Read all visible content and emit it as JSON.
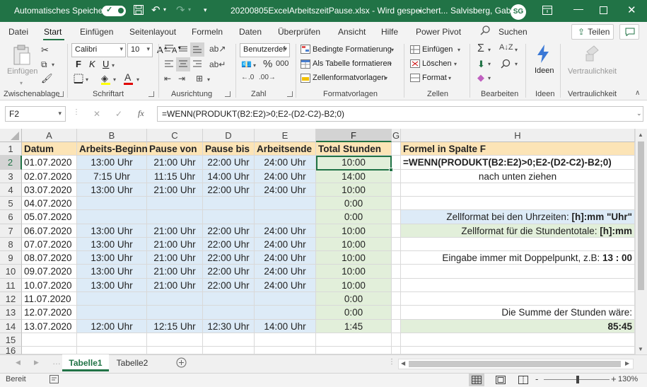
{
  "titlebar": {
    "autosave_label": "Automatisches Speichern",
    "autosave_state": "Ein",
    "doc_title": "20200805ExcelArbeitszeitPause.xlsx - Wird gespeichert... ",
    "user_name": "Salvisberg, Gaby",
    "user_initials": "SG"
  },
  "tabs": [
    "Datei",
    "Start",
    "Einfügen",
    "Seitenlayout",
    "Formeln",
    "Daten",
    "Überprüfen",
    "Ansicht",
    "Hilfe",
    "Power Pivot"
  ],
  "active_tab": "Start",
  "search_label": "Suchen",
  "share_label": "Teilen",
  "ribbon": {
    "clipboard": {
      "paste": "Einfügen",
      "label": "Zwischenablage"
    },
    "font": {
      "name": "Calibri",
      "size": "10",
      "bold": "F",
      "italic": "K",
      "underline": "U",
      "label": "Schriftart"
    },
    "alignment": {
      "label": "Ausrichtung"
    },
    "number": {
      "format": "Benutzerdef",
      "label": "Zahl"
    },
    "styles": {
      "conditional": "Bedingte Formatierung",
      "as_table": "Als Tabelle formatieren",
      "cell_styles": "Zellenformatvorlagen",
      "label": "Formatvorlagen"
    },
    "cells": {
      "insert": "Einfügen",
      "delete": "Löschen",
      "format": "Format",
      "label": "Zellen"
    },
    "editing": {
      "label": "Bearbeiten"
    },
    "ideas": {
      "button": "Ideen",
      "label": "Ideen"
    },
    "sensitivity": {
      "button": "Vertraulichkeit",
      "label": "Vertraulichkeit"
    }
  },
  "formula_bar": {
    "name_box": "F2",
    "fx": "fx",
    "formula": "=WENN(PRODUKT(B2:E2)>0;E2-(D2-C2)-B2;0)"
  },
  "columns": [
    "A",
    "B",
    "C",
    "D",
    "E",
    "F",
    "G",
    "H"
  ],
  "rows": [
    "1",
    "2",
    "3",
    "4",
    "5",
    "6",
    "7",
    "8",
    "9",
    "10",
    "11",
    "12",
    "13",
    "14",
    "15",
    "16"
  ],
  "headers": {
    "datum": "Datum",
    "beginn": "Arbeits-Beginn",
    "pause_von": "Pause von",
    "pause_bis": "Pause bis",
    "ende": "Arbeitsende",
    "total": "Total Stunden",
    "h_title": "Formel in Spalte F"
  },
  "data_rows": [
    {
      "datum": "01.07.2020",
      "beginn": "13:00 Uhr",
      "pause_von": "21:00 Uhr",
      "pause_bis": "22:00 Uhr",
      "ende": "24:00 Uhr",
      "total": "10:00"
    },
    {
      "datum": "02.07.2020",
      "beginn": "7:15 Uhr",
      "pause_von": "11:15 Uhr",
      "pause_bis": "14:00 Uhr",
      "ende": "24:00 Uhr",
      "total": "14:00"
    },
    {
      "datum": "03.07.2020",
      "beginn": "13:00 Uhr",
      "pause_von": "21:00 Uhr",
      "pause_bis": "22:00 Uhr",
      "ende": "24:00 Uhr",
      "total": "10:00"
    },
    {
      "datum": "04.07.2020",
      "beginn": "",
      "pause_von": "",
      "pause_bis": "",
      "ende": "",
      "total": "0:00"
    },
    {
      "datum": "05.07.2020",
      "beginn": "",
      "pause_von": "",
      "pause_bis": "",
      "ende": "",
      "total": "0:00"
    },
    {
      "datum": "06.07.2020",
      "beginn": "13:00 Uhr",
      "pause_von": "21:00 Uhr",
      "pause_bis": "22:00 Uhr",
      "ende": "24:00 Uhr",
      "total": "10:00"
    },
    {
      "datum": "07.07.2020",
      "beginn": "13:00 Uhr",
      "pause_von": "21:00 Uhr",
      "pause_bis": "22:00 Uhr",
      "ende": "24:00 Uhr",
      "total": "10:00"
    },
    {
      "datum": "08.07.2020",
      "beginn": "13:00 Uhr",
      "pause_von": "21:00 Uhr",
      "pause_bis": "22:00 Uhr",
      "ende": "24:00 Uhr",
      "total": "10:00"
    },
    {
      "datum": "09.07.2020",
      "beginn": "13:00 Uhr",
      "pause_von": "21:00 Uhr",
      "pause_bis": "22:00 Uhr",
      "ende": "24:00 Uhr",
      "total": "10:00"
    },
    {
      "datum": "10.07.2020",
      "beginn": "13:00 Uhr",
      "pause_von": "21:00 Uhr",
      "pause_bis": "22:00 Uhr",
      "ende": "24:00 Uhr",
      "total": "10:00"
    },
    {
      "datum": "11.07.2020",
      "beginn": "",
      "pause_von": "",
      "pause_bis": "",
      "ende": "",
      "total": "0:00"
    },
    {
      "datum": "12.07.2020",
      "beginn": "",
      "pause_von": "",
      "pause_bis": "",
      "ende": "",
      "total": "0:00"
    },
    {
      "datum": "13.07.2020",
      "beginn": "12:00 Uhr",
      "pause_von": "12:15 Uhr",
      "pause_bis": "12:30 Uhr",
      "ende": "14:00 Uhr",
      "total": "1:45"
    }
  ],
  "notes": {
    "formula": "=WENN(PRODUKT(B2:E2)>0;E2-(D2-C2)-B2;0)",
    "drag_down": "nach unten ziehen",
    "fmt_times_prefix": "Zellformat bei den Uhrzeiten: ",
    "fmt_times_value": "[h]:mm \"Uhr\"",
    "fmt_totals_prefix": "Zellformat für die Stundentotale: ",
    "fmt_totals_value": "[h]:mm",
    "entry_prefix": "Eingabe immer mit Doppelpunkt, z.B: ",
    "entry_value": "13 : 00",
    "sum_label": "Die Summe der Stunden wäre:",
    "sum_value": "85:45"
  },
  "sheets": [
    "Tabelle1",
    "Tabelle2"
  ],
  "active_sheet": "Tabelle1",
  "status": {
    "ready": "Bereit",
    "zoom": "130%",
    "zoom_minus": "-",
    "zoom_plus": "+"
  },
  "colors": {
    "brand": "#217346",
    "header_fill": "#fce4b6",
    "time_fill": "#ddebf7",
    "total_fill": "#e2efda"
  }
}
